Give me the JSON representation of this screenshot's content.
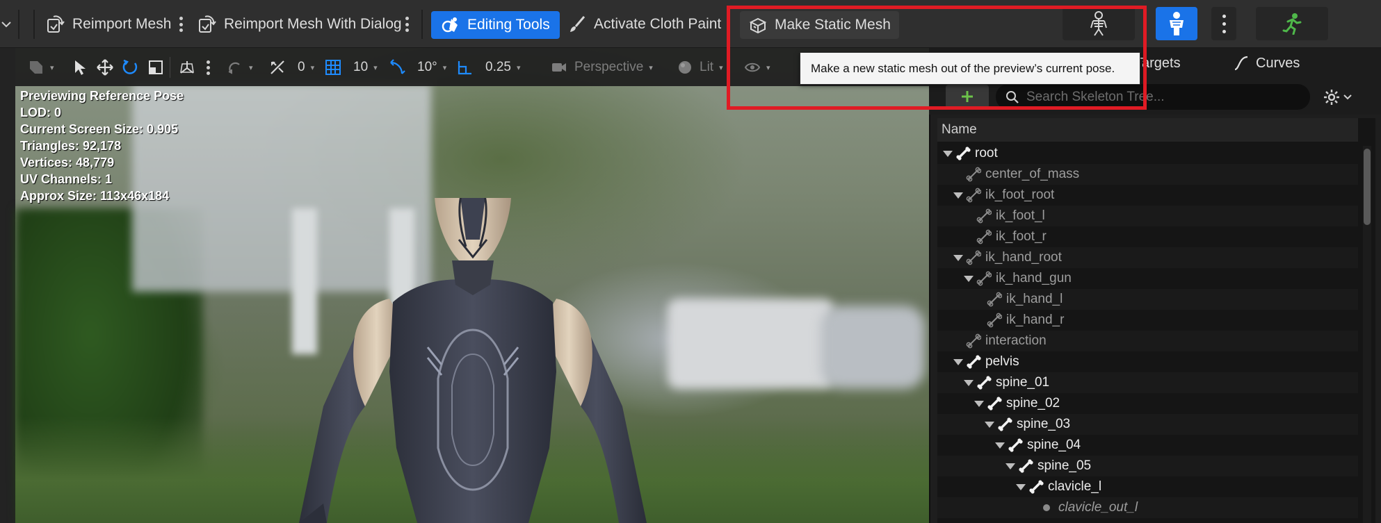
{
  "toolbar": {
    "reimport_mesh": "Reimport Mesh",
    "reimport_mesh_dialog": "Reimport Mesh With Dialog",
    "editing_tools": "Editing Tools",
    "activate_cloth_paint": "Activate Cloth Paint",
    "make_static_mesh": "Make Static Mesh",
    "icons": [
      "chevron-down-icon",
      "reimport-icon",
      "reimport-dialog-icon",
      "editing-tools-icon",
      "paint-brush-icon",
      "static-mesh-icon",
      "skeleton-icon",
      "mesh-icon",
      "running-figure-icon"
    ]
  },
  "tooltip": {
    "text": "Make a new static mesh out of the preview’s current pose."
  },
  "viewport_toolbar": {
    "rotation_snap": "0",
    "grid_snap": "10",
    "angle_snap": "10°",
    "scale_snap": "0.25",
    "perspective": "Perspective",
    "lit": "Lit"
  },
  "stats": {
    "line1": "Previewing Reference Pose",
    "line2": "LOD: 0",
    "line3": "Current Screen Size: 0.905",
    "line4": "Triangles: 92,178",
    "line5": "Vertices: 48,779",
    "line6": "UV Channels: 1",
    "line7": "Approx Size: 113x46x184"
  },
  "panel": {
    "tab_targets": "Targets",
    "tab_curves": "Curves",
    "search_placeholder": "Search Skeleton Tree...",
    "column_name": "Name"
  },
  "tree": [
    {
      "label": "root",
      "depth": 0,
      "expanded": true,
      "style": "strong"
    },
    {
      "label": "center_of_mass",
      "depth": 1,
      "expanded": false,
      "style": "weak"
    },
    {
      "label": "ik_foot_root",
      "depth": 1,
      "expanded": true,
      "style": "weak"
    },
    {
      "label": "ik_foot_l",
      "depth": 2,
      "expanded": false,
      "style": "weak"
    },
    {
      "label": "ik_foot_r",
      "depth": 2,
      "expanded": false,
      "style": "weak"
    },
    {
      "label": "ik_hand_root",
      "depth": 1,
      "expanded": true,
      "style": "weak"
    },
    {
      "label": "ik_hand_gun",
      "depth": 2,
      "expanded": true,
      "style": "weak"
    },
    {
      "label": "ik_hand_l",
      "depth": 3,
      "expanded": false,
      "style": "weak"
    },
    {
      "label": "ik_hand_r",
      "depth": 3,
      "expanded": false,
      "style": "weak"
    },
    {
      "label": "interaction",
      "depth": 1,
      "expanded": false,
      "style": "weak"
    },
    {
      "label": "pelvis",
      "depth": 1,
      "expanded": true,
      "style": "strong"
    },
    {
      "label": "spine_01",
      "depth": 2,
      "expanded": true,
      "style": "strong"
    },
    {
      "label": "spine_02",
      "depth": 3,
      "expanded": true,
      "style": "strong"
    },
    {
      "label": "spine_03",
      "depth": 4,
      "expanded": true,
      "style": "strong"
    },
    {
      "label": "spine_04",
      "depth": 5,
      "expanded": true,
      "style": "strong"
    },
    {
      "label": "spine_05",
      "depth": 6,
      "expanded": true,
      "style": "strong"
    },
    {
      "label": "clavicle_l",
      "depth": 7,
      "expanded": true,
      "style": "strong"
    },
    {
      "label": "clavicle_out_l",
      "depth": 8,
      "expanded": false,
      "style": "italic"
    }
  ],
  "colors": {
    "accent_blue": "#1a73e8",
    "highlight_red": "#e01b24",
    "add_green": "#6cc24a"
  }
}
